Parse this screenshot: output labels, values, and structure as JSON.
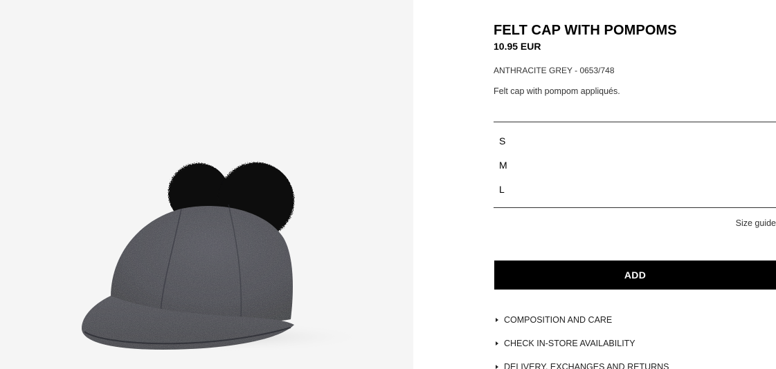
{
  "product": {
    "name": "FELT CAP WITH POMPOMS",
    "price": "10.95 EUR",
    "color_reference": "ANTHRACITE GREY - 0653/748",
    "description": "Felt cap with pompom appliqués.",
    "image_alt": "Anthracite grey felt cap with two black pompoms"
  },
  "sizes": [
    {
      "label": "S"
    },
    {
      "label": "M"
    },
    {
      "label": "L"
    }
  ],
  "size_guide_label": "Size guide",
  "add_button_label": "ADD",
  "accordion": [
    {
      "label": "COMPOSITION AND CARE"
    },
    {
      "label": "CHECK IN-STORE AVAILABILITY"
    },
    {
      "label": "DELIVERY, EXCHANGES AND RETURNS"
    }
  ],
  "colors": {
    "image_background": "#f5f5f5",
    "cap_felt": "#3e3f49",
    "pompom": "#0d0d0d",
    "button_background": "#000000",
    "button_text": "#ffffff"
  }
}
